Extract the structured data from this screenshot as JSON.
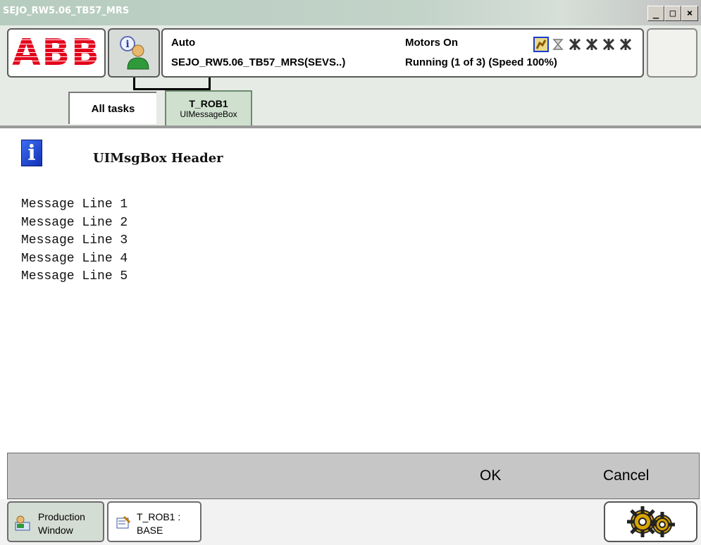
{
  "window": {
    "title": "SEJO_RW5.06_TB57_MRS",
    "minimize_icon": "minimize-icon",
    "maximize_icon": "maximize-icon",
    "close_icon": "close-icon"
  },
  "header": {
    "logo_text": "ABB",
    "info_icon": "user-info-icon",
    "status": {
      "mode": "Auto",
      "system": "SEJO_RW5.06_TB57_MRS(SEVS..)",
      "motors": "Motors On",
      "running": "Running (1 of 3) (Speed 100%)"
    }
  },
  "tabs": [
    {
      "label": "All tasks"
    },
    {
      "label": "T_ROB1",
      "sublabel": "UIMessageBox"
    }
  ],
  "message": {
    "header": "UIMsgBox Header",
    "lines": [
      "Message Line 1",
      "Message Line 2",
      "Message Line 3",
      "Message Line 4",
      "Message Line 5"
    ]
  },
  "buttons": {
    "ok": "OK",
    "cancel": "Cancel"
  },
  "taskbar": {
    "production_window": [
      "Production",
      "Window"
    ],
    "trob_base": [
      "T_ROB1 :",
      "BASE"
    ]
  },
  "colors": {
    "accent_red": "#e3001b",
    "info_blue": "#1f44d6",
    "tab_green": "#cfe0cf"
  }
}
